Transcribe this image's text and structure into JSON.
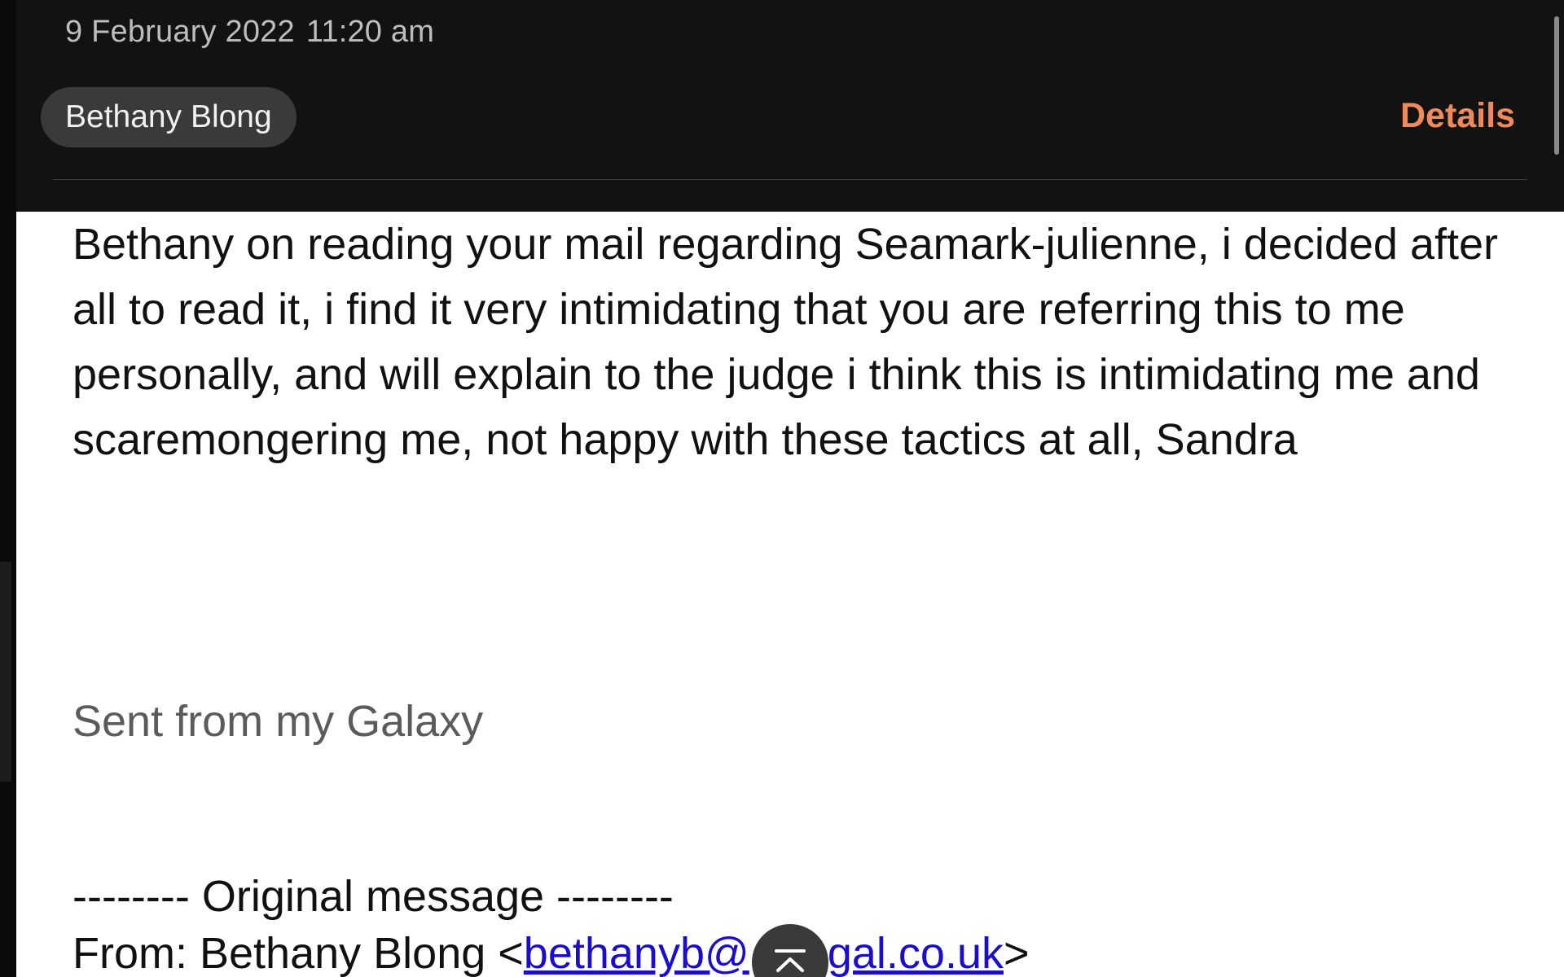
{
  "header": {
    "date": "9 February 2022",
    "time": "11:20 am",
    "sender_name": "Bethany Blong",
    "details_label": "Details"
  },
  "message": {
    "body": "Bethany on reading your mail regarding Seamark-julienne, i decided after all to read it, i find it very intimidating that you are referring this to me personally, and will explain to the judge i think this is intimidating me and scaremongering me, not happy with these tactics at all, Sandra",
    "signature": "Sent from my Galaxy",
    "original_divider": "-------- Original message --------",
    "from_prefix": "From: Bethany Blong <",
    "from_email": "bethanyb@",
    "from_email_domain": "legal.co.uk",
    "from_suffix": ">"
  },
  "icons": {
    "scroll_top": "chevron-up-icon"
  },
  "colors": {
    "header_bg": "#121212",
    "accent": "#f08a5d",
    "link": "#1a0dcc",
    "chip_bg": "#3a3a3a"
  }
}
